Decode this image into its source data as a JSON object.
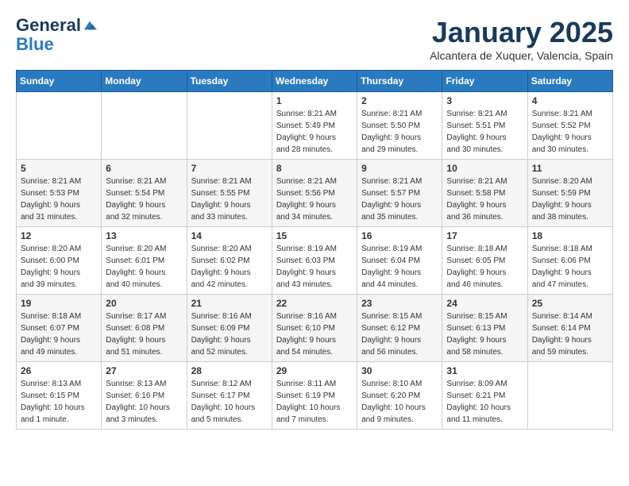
{
  "header": {
    "logo_line1": "General",
    "logo_line2": "Blue",
    "month": "January 2025",
    "location": "Alcantera de Xuquer, Valencia, Spain"
  },
  "weekdays": [
    "Sunday",
    "Monday",
    "Tuesday",
    "Wednesday",
    "Thursday",
    "Friday",
    "Saturday"
  ],
  "weeks": [
    [
      {
        "day": "",
        "info": ""
      },
      {
        "day": "",
        "info": ""
      },
      {
        "day": "",
        "info": ""
      },
      {
        "day": "1",
        "info": "Sunrise: 8:21 AM\nSunset: 5:49 PM\nDaylight: 9 hours\nand 28 minutes."
      },
      {
        "day": "2",
        "info": "Sunrise: 8:21 AM\nSunset: 5:50 PM\nDaylight: 9 hours\nand 29 minutes."
      },
      {
        "day": "3",
        "info": "Sunrise: 8:21 AM\nSunset: 5:51 PM\nDaylight: 9 hours\nand 30 minutes."
      },
      {
        "day": "4",
        "info": "Sunrise: 8:21 AM\nSunset: 5:52 PM\nDaylight: 9 hours\nand 30 minutes."
      }
    ],
    [
      {
        "day": "5",
        "info": "Sunrise: 8:21 AM\nSunset: 5:53 PM\nDaylight: 9 hours\nand 31 minutes."
      },
      {
        "day": "6",
        "info": "Sunrise: 8:21 AM\nSunset: 5:54 PM\nDaylight: 9 hours\nand 32 minutes."
      },
      {
        "day": "7",
        "info": "Sunrise: 8:21 AM\nSunset: 5:55 PM\nDaylight: 9 hours\nand 33 minutes."
      },
      {
        "day": "8",
        "info": "Sunrise: 8:21 AM\nSunset: 5:56 PM\nDaylight: 9 hours\nand 34 minutes."
      },
      {
        "day": "9",
        "info": "Sunrise: 8:21 AM\nSunset: 5:57 PM\nDaylight: 9 hours\nand 35 minutes."
      },
      {
        "day": "10",
        "info": "Sunrise: 8:21 AM\nSunset: 5:58 PM\nDaylight: 9 hours\nand 36 minutes."
      },
      {
        "day": "11",
        "info": "Sunrise: 8:20 AM\nSunset: 5:59 PM\nDaylight: 9 hours\nand 38 minutes."
      }
    ],
    [
      {
        "day": "12",
        "info": "Sunrise: 8:20 AM\nSunset: 6:00 PM\nDaylight: 9 hours\nand 39 minutes."
      },
      {
        "day": "13",
        "info": "Sunrise: 8:20 AM\nSunset: 6:01 PM\nDaylight: 9 hours\nand 40 minutes."
      },
      {
        "day": "14",
        "info": "Sunrise: 8:20 AM\nSunset: 6:02 PM\nDaylight: 9 hours\nand 42 minutes."
      },
      {
        "day": "15",
        "info": "Sunrise: 8:19 AM\nSunset: 6:03 PM\nDaylight: 9 hours\nand 43 minutes."
      },
      {
        "day": "16",
        "info": "Sunrise: 8:19 AM\nSunset: 6:04 PM\nDaylight: 9 hours\nand 44 minutes."
      },
      {
        "day": "17",
        "info": "Sunrise: 8:18 AM\nSunset: 6:05 PM\nDaylight: 9 hours\nand 46 minutes."
      },
      {
        "day": "18",
        "info": "Sunrise: 8:18 AM\nSunset: 6:06 PM\nDaylight: 9 hours\nand 47 minutes."
      }
    ],
    [
      {
        "day": "19",
        "info": "Sunrise: 8:18 AM\nSunset: 6:07 PM\nDaylight: 9 hours\nand 49 minutes."
      },
      {
        "day": "20",
        "info": "Sunrise: 8:17 AM\nSunset: 6:08 PM\nDaylight: 9 hours\nand 51 minutes."
      },
      {
        "day": "21",
        "info": "Sunrise: 8:16 AM\nSunset: 6:09 PM\nDaylight: 9 hours\nand 52 minutes."
      },
      {
        "day": "22",
        "info": "Sunrise: 8:16 AM\nSunset: 6:10 PM\nDaylight: 9 hours\nand 54 minutes."
      },
      {
        "day": "23",
        "info": "Sunrise: 8:15 AM\nSunset: 6:12 PM\nDaylight: 9 hours\nand 56 minutes."
      },
      {
        "day": "24",
        "info": "Sunrise: 8:15 AM\nSunset: 6:13 PM\nDaylight: 9 hours\nand 58 minutes."
      },
      {
        "day": "25",
        "info": "Sunrise: 8:14 AM\nSunset: 6:14 PM\nDaylight: 9 hours\nand 59 minutes."
      }
    ],
    [
      {
        "day": "26",
        "info": "Sunrise: 8:13 AM\nSunset: 6:15 PM\nDaylight: 10 hours\nand 1 minute."
      },
      {
        "day": "27",
        "info": "Sunrise: 8:13 AM\nSunset: 6:16 PM\nDaylight: 10 hours\nand 3 minutes."
      },
      {
        "day": "28",
        "info": "Sunrise: 8:12 AM\nSunset: 6:17 PM\nDaylight: 10 hours\nand 5 minutes."
      },
      {
        "day": "29",
        "info": "Sunrise: 8:11 AM\nSunset: 6:19 PM\nDaylight: 10 hours\nand 7 minutes."
      },
      {
        "day": "30",
        "info": "Sunrise: 8:10 AM\nSunset: 6:20 PM\nDaylight: 10 hours\nand 9 minutes."
      },
      {
        "day": "31",
        "info": "Sunrise: 8:09 AM\nSunset: 6:21 PM\nDaylight: 10 hours\nand 11 minutes."
      },
      {
        "day": "",
        "info": ""
      }
    ]
  ]
}
